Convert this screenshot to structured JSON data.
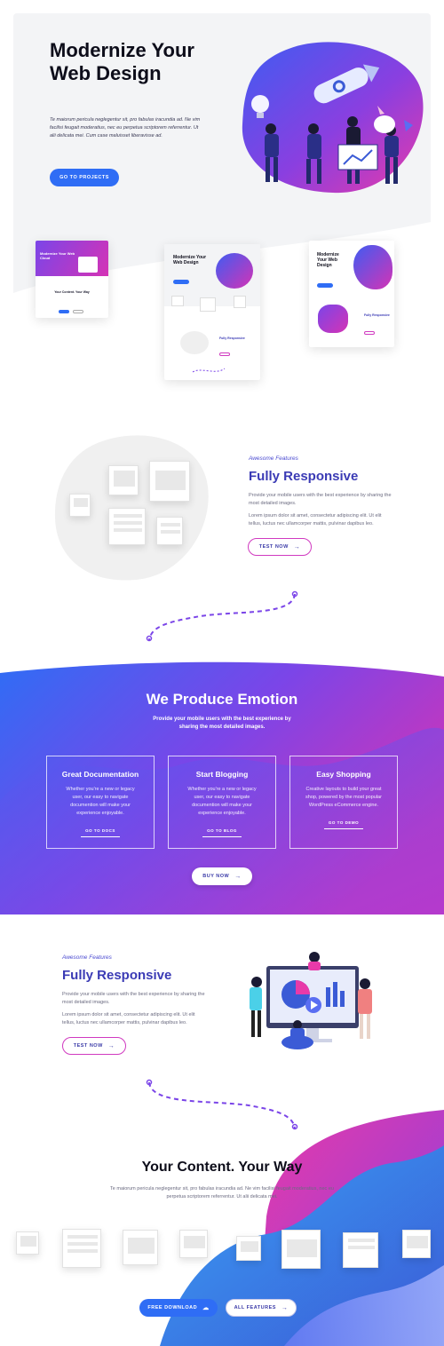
{
  "hero": {
    "title_line1": "Modernize Your",
    "title_line2": "Web Design",
    "text": "Te maiorum pericula neglegentur sit, pro fabulas iracundia ad. Ne vim facilisi feugait moderatius, nec eu perpetua scriptorem referrentur. Ut alii delicata mei. Cum case maluisset liberavisse ad.",
    "cta": "GO TO PROJECTS"
  },
  "previews": {
    "left_title": "Modernize Your Web Cloud",
    "left_sub": "Your Content. Your Way",
    "mid_title_line1": "Modernize Your",
    "mid_title_line2": "Web Design",
    "mid_feature": "Fully Responsive",
    "right_title_line1": "Modernize",
    "right_title_line2": "Your Web",
    "right_title_line3": "Design",
    "right_feature": "Fully Responsive"
  },
  "feature1": {
    "eyebrow": "Awesome Features",
    "title": "Fully Responsive",
    "para1": "Provide your mobile users with the best experience by sharing the most detailed images.",
    "para2": "Lorem ipsum dolor sit amet, consectetur adipiscing elit. Ut elit tellus, luctus nec ullamcorper mattis, pulvinar dapibus leo.",
    "cta": "TEST NOW"
  },
  "emotion": {
    "title": "We Produce Emotion",
    "subtitle": "Provide your mobile users with the best experience by sharing the most detailed images.",
    "cards": [
      {
        "title": "Great Documentation",
        "text": "Whether you're a new or legacy user, our easy to navigate documention will make your experience enjoyable.",
        "link": "GO TO DOCS"
      },
      {
        "title": "Start Blogging",
        "text": "Whether you're a new or legacy user, our easy to navigate documention will make your experience enjoyable.",
        "link": "GO TO BLOG"
      },
      {
        "title": "Easy Shopping",
        "text": "Creative layouts to build your great shop, powered by the most popular WordPress eCommerce engine.",
        "link": "GO TO DEMO"
      }
    ],
    "cta": "BUY NOW"
  },
  "feature2": {
    "eyebrow": "Awesome Features",
    "title": "Fully Responsive",
    "para1": "Provide your mobile users with the best experience by sharing the most detailed images.",
    "para2": "Lorem ipsum dolor sit amet, consectetur adipiscing elit. Ut elit tellus, luctus nec ullamcorper mattis, pulvinar dapibus leo.",
    "cta": "TEST NOW"
  },
  "final": {
    "title": "Your Content. Your Way",
    "text": "Te maiorum pericula neglegentur sit, pro fabulas iracundia ad. Ne vim facilisi feugait moderatius, nec eu perpetua scriptorem referrentur. Ut alii delicata mei.",
    "cta_primary": "FREE DOWNLOAD",
    "cta_secondary": "ALL FEATURES"
  },
  "colors": {
    "blue": "#2f6df5",
    "purple": "#7b45e8",
    "magenta": "#d533b5",
    "dark": "#0d0d1a"
  },
  "icons": [
    "cloud-download-icon",
    "arrow-right-icon"
  ]
}
